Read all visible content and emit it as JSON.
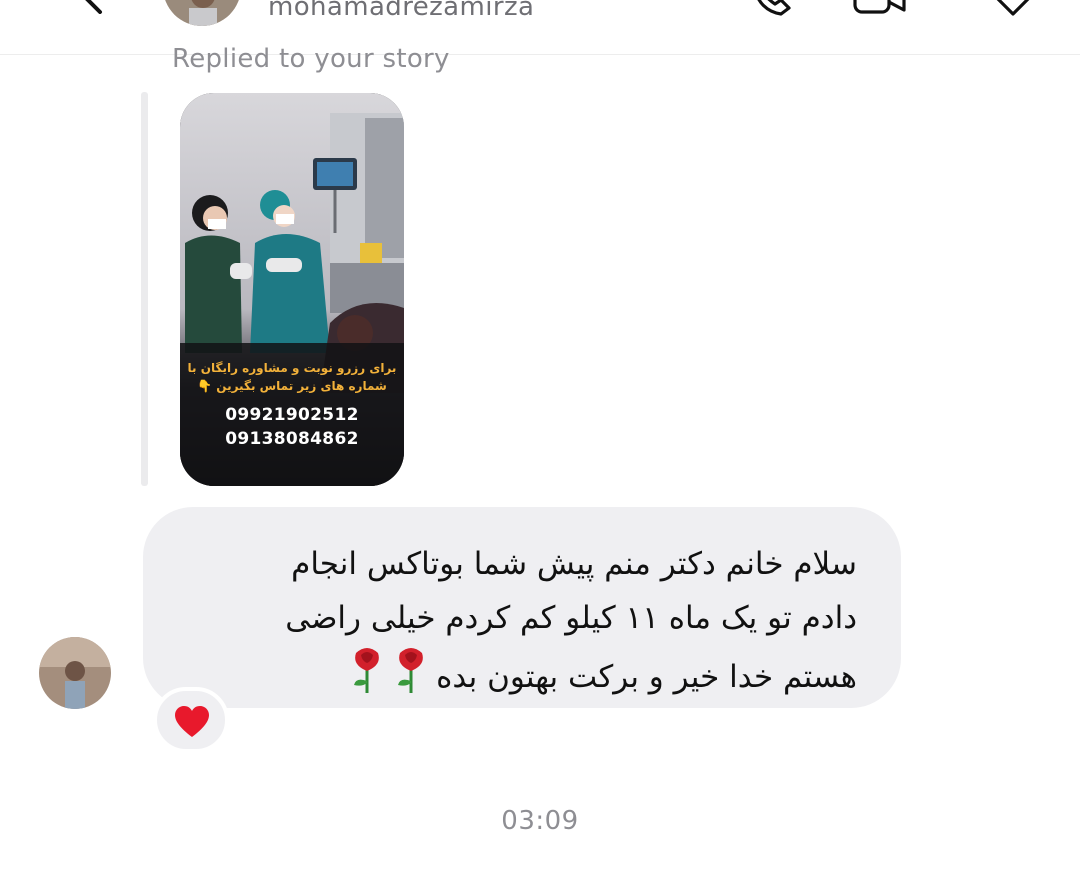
{
  "header": {
    "username": "mohamadrezamirza",
    "back_icon": "chevron-left-icon",
    "icons": [
      "phone-icon",
      "video-camera-icon",
      "tag-icon"
    ]
  },
  "reply": {
    "label": "Replied to your story",
    "story": {
      "promo_line1": "برای رزرو نوبت و مشاوره رایگان با",
      "promo_line2": "شماره های زیر تماس بگیرین 👇",
      "phone1": "09921902512",
      "phone2": "09138084862"
    }
  },
  "message": {
    "line1": "سلام خانم دکتر منم پیش شما بوتاکس انجام",
    "line2": "دادم تو یک ماه ۱۱ کیلو کم کردم خیلی راضی",
    "line3": "هستم خدا خیر و برکت بهتون بده",
    "emoji": "rose-icon",
    "reaction": "heart-icon"
  },
  "timestamp": "03:09",
  "colors": {
    "bubble": "#efeff2",
    "muted_text": "#8e8e93",
    "heart": "#e8192c",
    "promo_text": "#f2b13a"
  }
}
